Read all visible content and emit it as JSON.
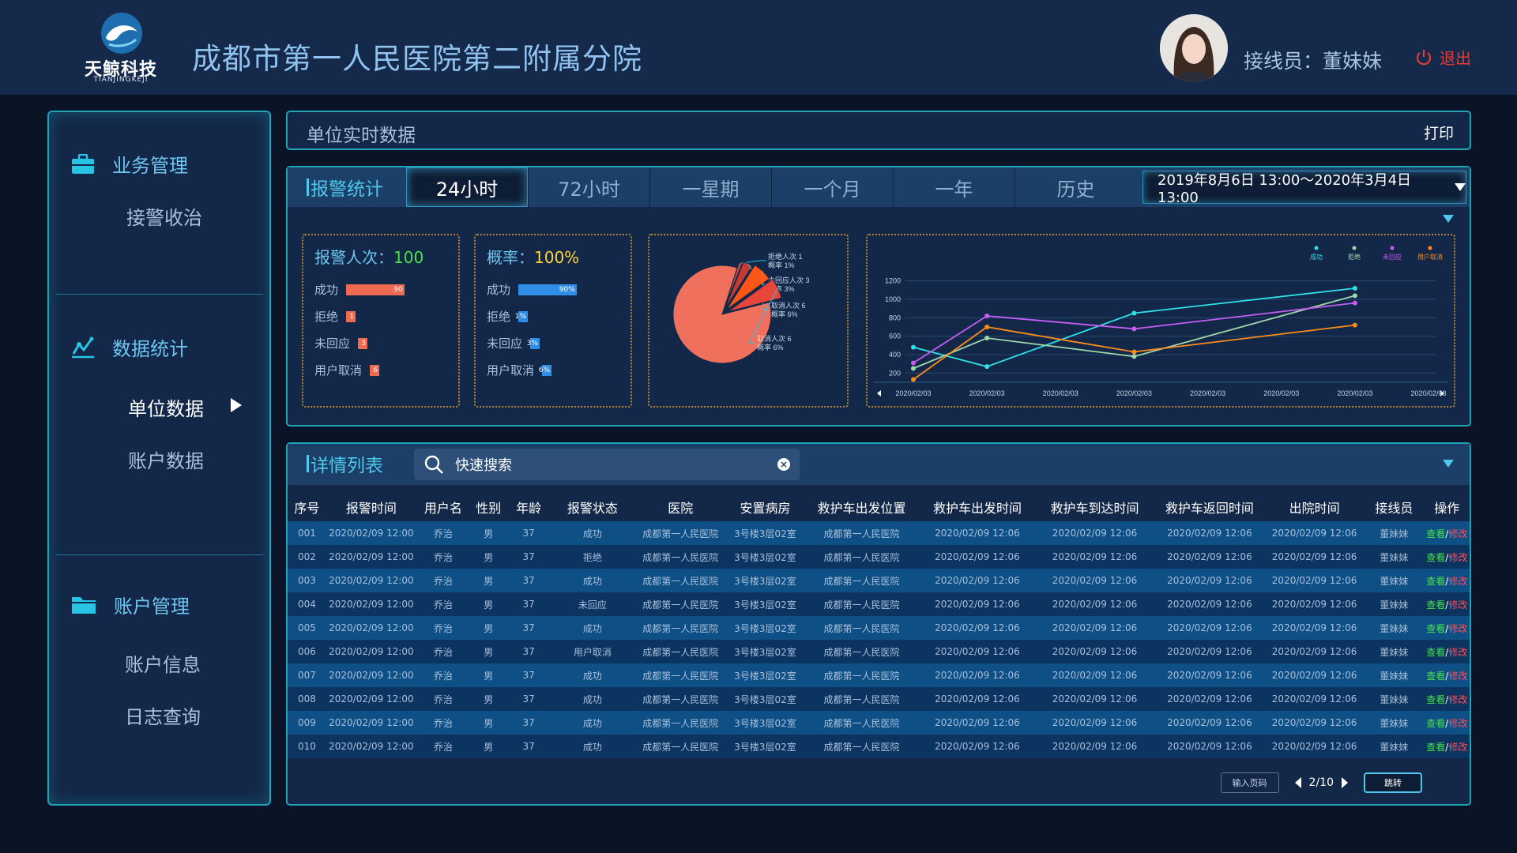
{
  "header": {
    "logo_text": "天鲸科技",
    "logo_sub": "TIANJINGKEJI",
    "hospital": "成都市第一人民医院第二附属分院",
    "operator_label": "接线员：",
    "operator_name": "董妹妹",
    "logout": "退出"
  },
  "sidebar": {
    "groups": [
      {
        "label": "业务管理",
        "icon": "briefcase-icon",
        "items": [
          "接警收治"
        ]
      },
      {
        "label": "数据统计",
        "icon": "chart-line-icon",
        "items": [
          "单位数据",
          "账户数据"
        ]
      },
      {
        "label": "账户管理",
        "icon": "folder-icon",
        "items": [
          "账户信息",
          "日志查询"
        ]
      }
    ]
  },
  "title_bar": {
    "title": "单位实时数据",
    "print": "打印"
  },
  "stats": {
    "label": "报警统计",
    "tabs": [
      "24小时",
      "72小时",
      "一星期",
      "一个月",
      "一年",
      "历史"
    ],
    "active_tab": "24小时",
    "daterange": "2019年8月6日 13:00～2020年3月4日 13:00",
    "count_card": {
      "head_label": "报警人次：",
      "head_value": "100",
      "rows": [
        {
          "label": "成功",
          "value": 90,
          "text": "90"
        },
        {
          "label": "拒绝",
          "value": 1,
          "text": "1"
        },
        {
          "label": "未回应",
          "value": 3,
          "text": "3"
        },
        {
          "label": "用户取消",
          "value": 6,
          "text": "6"
        }
      ]
    },
    "rate_card": {
      "head_label": "概率：",
      "head_value": "100%",
      "rows": [
        {
          "label": "成功",
          "value": 90,
          "text": "90%"
        },
        {
          "label": "拒绝",
          "value": 1,
          "text": "1%"
        },
        {
          "label": "未回应",
          "value": 3,
          "text": "3%"
        },
        {
          "label": "用户取消",
          "value": 6,
          "text": "6%"
        }
      ]
    }
  },
  "chart_data": [
    {
      "type": "pie",
      "slices": [
        {
          "name": "成功",
          "value": 84,
          "color": "#f0705e"
        },
        {
          "name": "拒绝",
          "value": 1,
          "color": "#d9463a",
          "label1": "拒绝人次 1",
          "label2": "概率 1%"
        },
        {
          "name": "未回应",
          "value": 3,
          "color": "#c73a33",
          "label1": "未回应人次 3",
          "label2": "概率 3%"
        },
        {
          "name": "取消",
          "value": 6,
          "color": "#ff5516",
          "label1": "取消人次 6",
          "label2": "概率 6%"
        },
        {
          "name": "取消",
          "value": 6,
          "color": "#e8463a",
          "label1": "取消人次 6",
          "label2": "概率 6%"
        }
      ]
    },
    {
      "type": "line",
      "x": [
        "2020/02/03",
        "2020/02/03",
        "2020/02/03",
        "2020/02/03",
        "2020/02/03",
        "2020/02/03",
        "2020/02/03",
        "2020/02/03"
      ],
      "y_ticks": [
        200,
        400,
        600,
        800,
        1000,
        1200
      ],
      "ylim": [
        100,
        1300
      ],
      "grid": true,
      "legend_position": "top-right",
      "series": [
        {
          "name": "成功",
          "color": "#2fe0e8",
          "values": [
            480,
            270,
            null,
            850,
            null,
            null,
            1120
          ]
        },
        {
          "name": "拒绝",
          "color": "#9fd8a8",
          "values": [
            250,
            580,
            null,
            380,
            null,
            null,
            1040
          ]
        },
        {
          "name": "未回应",
          "color": "#c55ef5",
          "values": [
            310,
            820,
            null,
            680,
            null,
            null,
            960
          ]
        },
        {
          "name": "用户取消",
          "color": "#ff8c1a",
          "values": [
            130,
            700,
            null,
            430,
            null,
            null,
            720
          ]
        }
      ]
    }
  ],
  "list": {
    "label": "详情列表",
    "search_placeholder": "快速搜索",
    "columns": [
      "序号",
      "报警时间",
      "用户名",
      "性别",
      "年龄",
      "报警状态",
      "医院",
      "安置病房",
      "救护车出发位置",
      "救护车出发时间",
      "救护车到达时间",
      "救护车返回时间",
      "出院时间",
      "接线员",
      "操作"
    ],
    "rows": [
      [
        "001",
        "2020/02/09 12:00",
        "乔治",
        "男",
        "37",
        "成功",
        "成都第一人民医院",
        "3号楼3层02室",
        "成都第一人民医院",
        "2020/02/09 12:06",
        "2020/02/09 12:06",
        "2020/02/09 12:06",
        "2020/02/09 12:06",
        "董妹妹"
      ],
      [
        "002",
        "2020/02/09 12:00",
        "乔治",
        "男",
        "37",
        "拒绝",
        "成都第一人民医院",
        "3号楼3层02室",
        "成都第一人民医院",
        "2020/02/09 12:06",
        "2020/02/09 12:06",
        "2020/02/09 12:06",
        "2020/02/09 12:06",
        "董妹妹"
      ],
      [
        "003",
        "2020/02/09 12:00",
        "乔治",
        "男",
        "37",
        "成功",
        "成都第一人民医院",
        "3号楼3层02室",
        "成都第一人民医院",
        "2020/02/09 12:06",
        "2020/02/09 12:06",
        "2020/02/09 12:06",
        "2020/02/09 12:06",
        "董妹妹"
      ],
      [
        "004",
        "2020/02/09 12:00",
        "乔治",
        "男",
        "37",
        "未回应",
        "成都第一人民医院",
        "3号楼3层02室",
        "成都第一人民医院",
        "2020/02/09 12:06",
        "2020/02/09 12:06",
        "2020/02/09 12:06",
        "2020/02/09 12:06",
        "董妹妹"
      ],
      [
        "005",
        "2020/02/09 12:00",
        "乔治",
        "男",
        "37",
        "成功",
        "成都第一人民医院",
        "3号楼3层02室",
        "成都第一人民医院",
        "2020/02/09 12:06",
        "2020/02/09 12:06",
        "2020/02/09 12:06",
        "2020/02/09 12:06",
        "董妹妹"
      ],
      [
        "006",
        "2020/02/09 12:00",
        "乔治",
        "男",
        "37",
        "用户取消",
        "成都第一人民医院",
        "3号楼3层02室",
        "成都第一人民医院",
        "2020/02/09 12:06",
        "2020/02/09 12:06",
        "2020/02/09 12:06",
        "2020/02/09 12:06",
        "董妹妹"
      ],
      [
        "007",
        "2020/02/09 12:00",
        "乔治",
        "男",
        "37",
        "成功",
        "成都第一人民医院",
        "3号楼3层02室",
        "成都第一人民医院",
        "2020/02/09 12:06",
        "2020/02/09 12:06",
        "2020/02/09 12:06",
        "2020/02/09 12:06",
        "董妹妹"
      ],
      [
        "008",
        "2020/02/09 12:00",
        "乔治",
        "男",
        "37",
        "成功",
        "成都第一人民医院",
        "3号楼3层02室",
        "成都第一人民医院",
        "2020/02/09 12:06",
        "2020/02/09 12:06",
        "2020/02/09 12:06",
        "2020/02/09 12:06",
        "董妹妹"
      ],
      [
        "009",
        "2020/02/09 12:00",
        "乔治",
        "男",
        "37",
        "成功",
        "成都第一人民医院",
        "3号楼3层02室",
        "成都第一人民医院",
        "2020/02/09 12:06",
        "2020/02/09 12:06",
        "2020/02/09 12:06",
        "2020/02/09 12:06",
        "董妹妹"
      ],
      [
        "010",
        "2020/02/09 12:00",
        "乔治",
        "男",
        "37",
        "成功",
        "成都第一人民医院",
        "3号楼3层02室",
        "成都第一人民医院",
        "2020/02/09 12:06",
        "2020/02/09 12:06",
        "2020/02/09 12:06",
        "2020/02/09 12:06",
        "董妹妹"
      ]
    ],
    "view_label": "查看",
    "sep": "/",
    "edit_label": "修改"
  },
  "pager": {
    "input_placeholder": "输入页码",
    "page": "2/10",
    "jump": "跳转"
  }
}
